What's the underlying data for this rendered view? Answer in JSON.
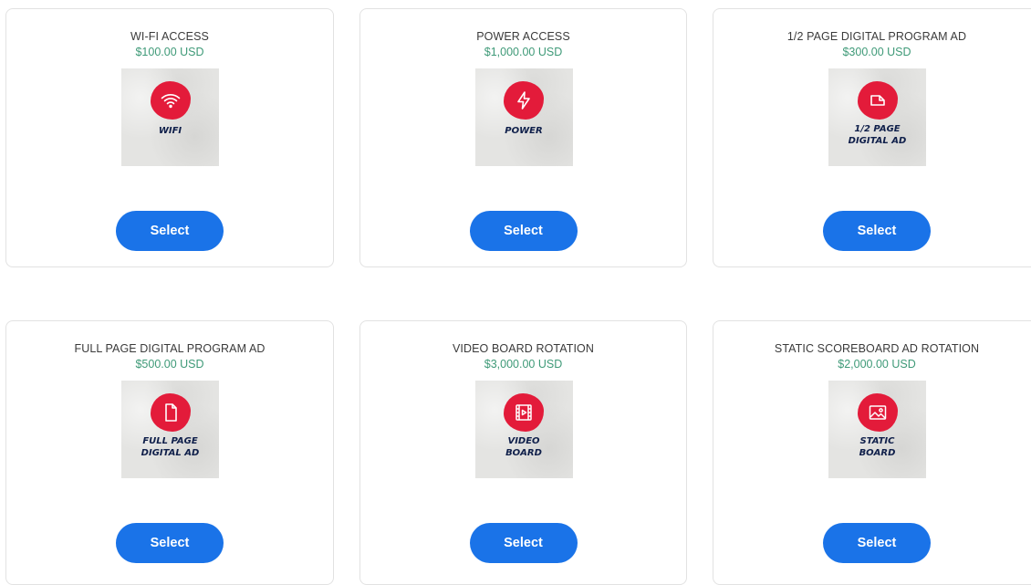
{
  "products": [
    {
      "title": "WI-FI ACCESS",
      "price": "$100.00 USD",
      "icon": "wifi-icon",
      "thumb_text": "WIFI",
      "button_label": "Select"
    },
    {
      "title": "POWER ACCESS",
      "price": "$1,000.00 USD",
      "icon": "power-icon",
      "thumb_text": "POWER",
      "button_label": "Select"
    },
    {
      "title": "1/2 PAGE DIGITAL PROGRAM AD",
      "price": "$300.00 USD",
      "icon": "page-icon",
      "thumb_text": "1/2 PAGE\nDIGITAL AD",
      "button_label": "Select"
    },
    {
      "title": "FULL PAGE DIGITAL PROGRAM AD",
      "price": "$500.00 USD",
      "icon": "document-icon",
      "thumb_text": "FULL PAGE\nDIGITAL AD",
      "button_label": "Select"
    },
    {
      "title": "VIDEO BOARD ROTATION",
      "price": "$3,000.00 USD",
      "icon": "video-icon",
      "thumb_text": "VIDEO\nBOARD",
      "button_label": "Select"
    },
    {
      "title": "STATIC SCOREBOARD AD ROTATION",
      "price": "$2,000.00 USD",
      "icon": "image-icon",
      "thumb_text": "STATIC\nBOARD",
      "button_label": "Select"
    }
  ],
  "colors": {
    "accent": "#1a73e8",
    "price": "#3f9a78",
    "icon_blob": "#e31b3a",
    "thumb_text": "#0f1f4a"
  }
}
